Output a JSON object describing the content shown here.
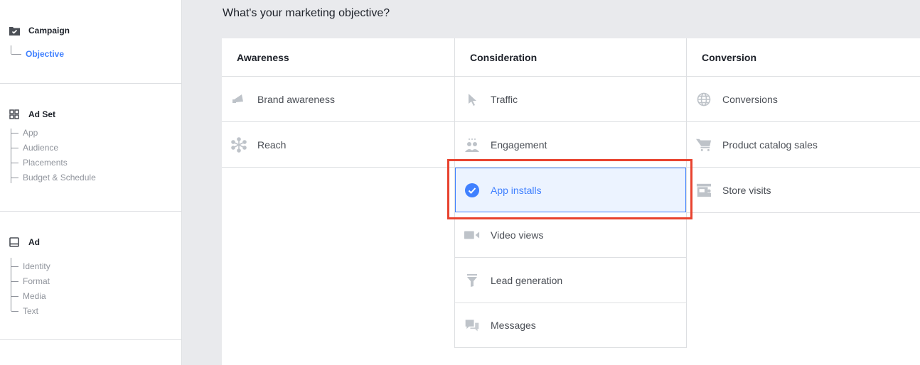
{
  "sidebar": {
    "campaign": {
      "label": "Campaign",
      "icon": "folder-check-icon",
      "items": [
        "Objective"
      ]
    },
    "adset": {
      "label": "Ad Set",
      "icon": "grid-icon",
      "items": [
        "App",
        "Audience",
        "Placements",
        "Budget & Schedule"
      ]
    },
    "ad": {
      "label": "Ad",
      "icon": "monitor-icon",
      "items": [
        "Identity",
        "Format",
        "Media",
        "Text"
      ]
    }
  },
  "main": {
    "title": "What's your marketing objective?",
    "columns": [
      {
        "label": "Awareness",
        "options": [
          {
            "label": "Brand awareness",
            "icon": "megaphone-icon"
          },
          {
            "label": "Reach",
            "icon": "reach-icon"
          }
        ]
      },
      {
        "label": "Consideration",
        "options": [
          {
            "label": "Traffic",
            "icon": "cursor-icon"
          },
          {
            "label": "Engagement",
            "icon": "people-icon"
          },
          {
            "label": "App installs",
            "icon": "check-circle-icon",
            "selected": true
          },
          {
            "label": "Video views",
            "icon": "video-camera-icon"
          },
          {
            "label": "Lead generation",
            "icon": "funnel-icon"
          },
          {
            "label": "Messages",
            "icon": "chat-bubbles-icon"
          }
        ]
      },
      {
        "label": "Conversion",
        "options": [
          {
            "label": "Conversions",
            "icon": "globe-icon"
          },
          {
            "label": "Product catalog sales",
            "icon": "cart-icon"
          },
          {
            "label": "Store visits",
            "icon": "store-icon"
          }
        ]
      }
    ]
  },
  "colors": {
    "accent": "#4080ff",
    "selected_bg": "#ecf3ff",
    "highlight": "#e8432f"
  }
}
